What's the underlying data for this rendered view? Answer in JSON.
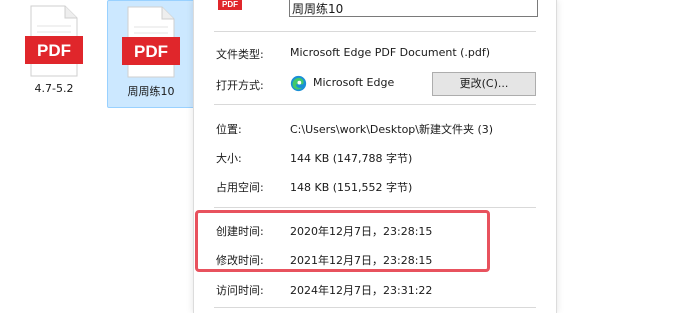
{
  "desktop": {
    "files": [
      {
        "badge": "PDF",
        "label": "4.7-5.2"
      },
      {
        "badge": "PDF",
        "label": "周周练10"
      }
    ]
  },
  "dialog": {
    "file_name": "周周练10",
    "file_type_label": "文件类型:",
    "file_type_value": "Microsoft Edge PDF Document (.pdf)",
    "opens_with_label": "打开方式:",
    "opens_with_app": "Microsoft Edge",
    "change_button": "更改(C)...",
    "location_label": "位置:",
    "location_value": "C:\\Users\\work\\Desktop\\新建文件夹 (3)",
    "size_label": "大小:",
    "size_value": "144 KB (147,788 字节)",
    "size_on_disk_label": "占用空间:",
    "size_on_disk_value": "148 KB (151,552 字节)",
    "created_label": "创建时间:",
    "created_value": "2020年12月7日，23:28:15",
    "modified_label": "修改时间:",
    "modified_value": "2021年12月7日，23:28:15",
    "accessed_label": "访问时间:",
    "accessed_value": "2024年12月7日，23:31:22"
  },
  "colors": {
    "pdf_red": "#e0262b",
    "highlight": "#e8525e",
    "selection": "#cce8ff"
  }
}
